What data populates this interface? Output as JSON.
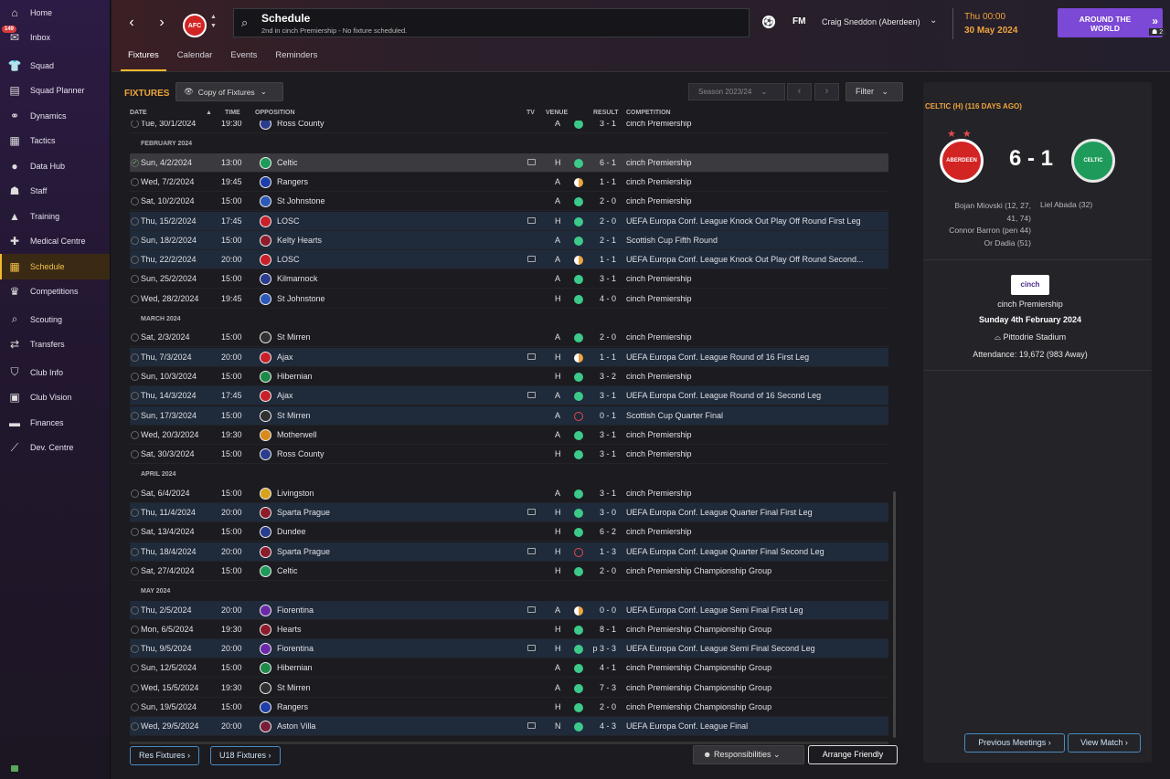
{
  "sidebar": {
    "items": [
      {
        "label": "Home",
        "icon": "home-icon",
        "glyph": "⌂"
      },
      {
        "label": "Inbox",
        "icon": "inbox-icon",
        "glyph": "✉",
        "badge": "149"
      },
      {
        "label": "Squad",
        "icon": "shirt-icon",
        "glyph": "👕"
      },
      {
        "label": "Squad Planner",
        "icon": "clipboard-icon",
        "glyph": "▤"
      },
      {
        "label": "Dynamics",
        "icon": "handshake-icon",
        "glyph": "⚭"
      },
      {
        "label": "Tactics",
        "icon": "tactics-board-icon",
        "glyph": "▦"
      },
      {
        "label": "Data Hub",
        "icon": "data-hub-icon",
        "glyph": "●"
      },
      {
        "label": "Staff",
        "icon": "staff-icon",
        "glyph": "☗"
      },
      {
        "label": "Training",
        "icon": "training-cone-icon",
        "glyph": "▲"
      },
      {
        "label": "Medical Centre",
        "icon": "medical-icon",
        "glyph": "✚"
      },
      {
        "label": "Schedule",
        "icon": "calendar-icon",
        "glyph": "▦",
        "active": true
      },
      {
        "label": "Competitions",
        "icon": "trophy-icon",
        "glyph": "♛"
      },
      {
        "label": "Scouting",
        "icon": "scouting-icon",
        "glyph": "⌕"
      },
      {
        "label": "Transfers",
        "icon": "transfers-icon",
        "glyph": "⇄"
      },
      {
        "label": "Club Info",
        "icon": "shield-icon",
        "glyph": "⛉"
      },
      {
        "label": "Club Vision",
        "icon": "briefcase-icon",
        "glyph": "▣"
      },
      {
        "label": "Finances",
        "icon": "money-icon",
        "glyph": "▬"
      },
      {
        "label": "Dev. Centre",
        "icon": "dev-centre-icon",
        "glyph": "⟋"
      }
    ]
  },
  "header": {
    "club_crest": "AFC",
    "title": "Schedule",
    "subtitle": "2nd in cinch Premiership - No fixture scheduled.",
    "fm": "FM",
    "manager": "Craig Sneddon (Aberdeen)",
    "time": "Thu 00:00",
    "date": "30 May 2024",
    "continue_label": "AROUND THE WORLD",
    "manager_count": "2",
    "tabs": [
      "Fixtures",
      "Calendar",
      "Events",
      "Reminders"
    ]
  },
  "toolbar": {
    "section": "FIXTURES",
    "view": "Copy of Fixtures",
    "season": "Season 2023/24",
    "filter": "Filter"
  },
  "columns": {
    "date": "DATE",
    "time": "TIME",
    "opposition": "OPPOSITION",
    "tv": "TV",
    "venue": "VENUE",
    "result": "RESULT",
    "competition": "COMPETITION"
  },
  "rows": [
    {
      "type": "match",
      "date": "Tue, 30/1/2024",
      "time": "19:30",
      "opp": "Ross County",
      "color": "#2a3c8c",
      "tv": false,
      "venue": "A",
      "res": "w",
      "score": "3 - 1",
      "comp": "cinch Premiership"
    },
    {
      "type": "month",
      "label": "FEBRUARY 2024"
    },
    {
      "type": "match",
      "date": "Sun, 4/2/2024",
      "time": "13:00",
      "opp": "Celtic",
      "color": "#1e9b5a",
      "tv": true,
      "venue": "H",
      "res": "w",
      "score": "6 - 1",
      "comp": "cinch Premiership",
      "sel": true
    },
    {
      "type": "match",
      "date": "Wed, 7/2/2024",
      "time": "19:45",
      "opp": "Rangers",
      "color": "#1f3fa8",
      "tv": false,
      "venue": "A",
      "res": "d",
      "score": "1 - 1",
      "comp": "cinch Premiership"
    },
    {
      "type": "match",
      "date": "Sat, 10/2/2024",
      "time": "15:00",
      "opp": "St Johnstone",
      "color": "#2d58b8",
      "tv": false,
      "venue": "A",
      "res": "w",
      "score": "2 - 0",
      "comp": "cinch Premiership"
    },
    {
      "type": "match",
      "date": "Thu, 15/2/2024",
      "time": "17:45",
      "opp": "LOSC",
      "color": "#c8202a",
      "tv": true,
      "venue": "H",
      "res": "w",
      "score": "2 - 0",
      "comp": "UEFA Europa Conf. League Knock Out Play Off Round First Leg",
      "hl": true
    },
    {
      "type": "match",
      "date": "Sun, 18/2/2024",
      "time": "15:00",
      "opp": "Kelty Hearts",
      "color": "#8c1c2a",
      "tv": false,
      "venue": "A",
      "res": "w",
      "score": "2 - 1",
      "comp": "Scottish Cup Fifth Round",
      "hl": true
    },
    {
      "type": "match",
      "date": "Thu, 22/2/2024",
      "time": "20:00",
      "opp": "LOSC",
      "color": "#c8202a",
      "tv": true,
      "venue": "A",
      "res": "d",
      "score": "1 - 1",
      "comp": "UEFA Europa Conf. League Knock Out Play Off Round Second...",
      "hl": true
    },
    {
      "type": "match",
      "date": "Sun, 25/2/2024",
      "time": "15:00",
      "opp": "Kilmarnock",
      "color": "#2a3c8c",
      "tv": false,
      "venue": "A",
      "res": "w",
      "score": "3 - 1",
      "comp": "cinch Premiership"
    },
    {
      "type": "match",
      "date": "Wed, 28/2/2024",
      "time": "19:45",
      "opp": "St Johnstone",
      "color": "#2d58b8",
      "tv": false,
      "venue": "H",
      "res": "w",
      "score": "4 - 0",
      "comp": "cinch Premiership"
    },
    {
      "type": "month",
      "label": "MARCH 2024"
    },
    {
      "type": "match",
      "date": "Sat, 2/3/2024",
      "time": "15:00",
      "opp": "St Mirren",
      "color": "#303030",
      "tv": false,
      "venue": "A",
      "res": "w",
      "score": "2 - 0",
      "comp": "cinch Premiership"
    },
    {
      "type": "match",
      "date": "Thu, 7/3/2024",
      "time": "20:00",
      "opp": "Ajax",
      "color": "#c8202a",
      "tv": true,
      "venue": "H",
      "res": "d",
      "score": "1 - 1",
      "comp": "UEFA Europa Conf. League Round of 16  First Leg",
      "hl": true
    },
    {
      "type": "match",
      "date": "Sun, 10/3/2024",
      "time": "15:00",
      "opp": "Hibernian",
      "color": "#1e8a4a",
      "tv": false,
      "venue": "H",
      "res": "w",
      "score": "3 - 2",
      "comp": "cinch Premiership"
    },
    {
      "type": "match",
      "date": "Thu, 14/3/2024",
      "time": "17:45",
      "opp": "Ajax",
      "color": "#c8202a",
      "tv": true,
      "venue": "A",
      "res": "w",
      "score": "3 - 1",
      "comp": "UEFA Europa Conf. League Round of 16  Second Leg",
      "hl": true
    },
    {
      "type": "match",
      "date": "Sun, 17/3/2024",
      "time": "15:00",
      "opp": "St Mirren",
      "color": "#303030",
      "tv": false,
      "venue": "A",
      "res": "l",
      "score": "0 - 1",
      "comp": "Scottish Cup Quarter Final",
      "hl": true
    },
    {
      "type": "match",
      "date": "Wed, 20/3/2024",
      "time": "19:30",
      "opp": "Motherwell",
      "color": "#d8891c",
      "tv": false,
      "venue": "A",
      "res": "w",
      "score": "3 - 1",
      "comp": "cinch Premiership"
    },
    {
      "type": "match",
      "date": "Sat, 30/3/2024",
      "time": "15:00",
      "opp": "Ross County",
      "color": "#2a3c8c",
      "tv": false,
      "venue": "H",
      "res": "w",
      "score": "3 - 1",
      "comp": "cinch Premiership"
    },
    {
      "type": "month",
      "label": "APRIL 2024"
    },
    {
      "type": "match",
      "date": "Sat, 6/4/2024",
      "time": "15:00",
      "opp": "Livingston",
      "color": "#d8a21c",
      "tv": false,
      "venue": "A",
      "res": "w",
      "score": "3 - 1",
      "comp": "cinch Premiership"
    },
    {
      "type": "match",
      "date": "Thu, 11/4/2024",
      "time": "20:00",
      "opp": "Sparta Prague",
      "color": "#8c1c2a",
      "tv": true,
      "venue": "H",
      "res": "w",
      "score": "3 - 0",
      "comp": "UEFA Europa Conf. League Quarter Final First Leg",
      "hl": true
    },
    {
      "type": "match",
      "date": "Sat, 13/4/2024",
      "time": "15:00",
      "opp": "Dundee",
      "color": "#2a3c8c",
      "tv": false,
      "venue": "H",
      "res": "w",
      "score": "6 - 2",
      "comp": "cinch Premiership"
    },
    {
      "type": "match",
      "date": "Thu, 18/4/2024",
      "time": "20:00",
      "opp": "Sparta Prague",
      "color": "#8c1c2a",
      "tv": true,
      "venue": "H",
      "res": "l",
      "score": "1 - 3",
      "comp": "UEFA Europa Conf. League Quarter Final Second Leg",
      "hl": true
    },
    {
      "type": "match",
      "date": "Sat, 27/4/2024",
      "time": "15:00",
      "opp": "Celtic",
      "color": "#1e9b5a",
      "tv": false,
      "venue": "H",
      "res": "w",
      "score": "2 - 0",
      "comp": "cinch Premiership Championship Group"
    },
    {
      "type": "month",
      "label": "MAY 2024"
    },
    {
      "type": "match",
      "date": "Thu, 2/5/2024",
      "time": "20:00",
      "opp": "Fiorentina",
      "color": "#6a2aa8",
      "tv": true,
      "venue": "A",
      "res": "d",
      "score": "0 - 0",
      "comp": "UEFA Europa Conf. League Semi Final First Leg",
      "hl": true
    },
    {
      "type": "match",
      "date": "Mon, 6/5/2024",
      "time": "19:30",
      "opp": "Hearts",
      "color": "#8c1c2a",
      "tv": false,
      "venue": "H",
      "res": "w",
      "score": "8 - 1",
      "comp": "cinch Premiership Championship Group"
    },
    {
      "type": "match",
      "date": "Thu, 9/5/2024",
      "time": "20:00",
      "opp": "Fiorentina",
      "color": "#6a2aa8",
      "tv": true,
      "venue": "H",
      "res": "w",
      "score": "p 3 - 3",
      "comp": "UEFA Europa Conf. League Semi Final Second Leg",
      "hl": true
    },
    {
      "type": "match",
      "date": "Sun, 12/5/2024",
      "time": "15:00",
      "opp": "Hibernian",
      "color": "#1e8a4a",
      "tv": false,
      "venue": "A",
      "res": "w",
      "score": "4 - 1",
      "comp": "cinch Premiership Championship Group"
    },
    {
      "type": "match",
      "date": "Wed, 15/5/2024",
      "time": "19:30",
      "opp": "St Mirren",
      "color": "#303030",
      "tv": false,
      "venue": "A",
      "res": "w",
      "score": "7 - 3",
      "comp": "cinch Premiership Championship Group"
    },
    {
      "type": "match",
      "date": "Sun, 19/5/2024",
      "time": "15:00",
      "opp": "Rangers",
      "color": "#1f3fa8",
      "tv": false,
      "venue": "H",
      "res": "w",
      "score": "2 - 0",
      "comp": "cinch Premiership Championship Group"
    },
    {
      "type": "match",
      "date": "Wed, 29/5/2024",
      "time": "20:00",
      "opp": "Aston Villa",
      "color": "#7a1c3a",
      "tv": true,
      "venue": "N",
      "res": "w",
      "score": "4 - 3",
      "comp": "UEFA Europa Conf. League Final",
      "hl": true
    }
  ],
  "footer": {
    "res": "Res Fixtures",
    "u18": "U18 Fixtures",
    "responsibilities": "Responsibilities",
    "arrange": "Arrange Friendly"
  },
  "match_panel": {
    "title": "CELTIC (H) (116 DAYS AGO)",
    "stars": "★ ★",
    "home_crest": "ABERDEEN",
    "away_crest": "CELTIC",
    "score": "6 - 1",
    "home_scorers": [
      "Bojan Miovski (12, 27,",
      "41, 74)",
      "Connor Barron (pen 44)",
      "Or Dadia (51)"
    ],
    "away_scorers": "Liel Abada (32)",
    "competition_logo": "cinch",
    "competition": "cinch Premiership",
    "date": "Sunday 4th February 2024",
    "stadium": "Pittodrie Stadium",
    "attendance": "Attendance: 19,672 (983 Away)",
    "previous": "Previous Meetings",
    "view_match": "View Match"
  }
}
